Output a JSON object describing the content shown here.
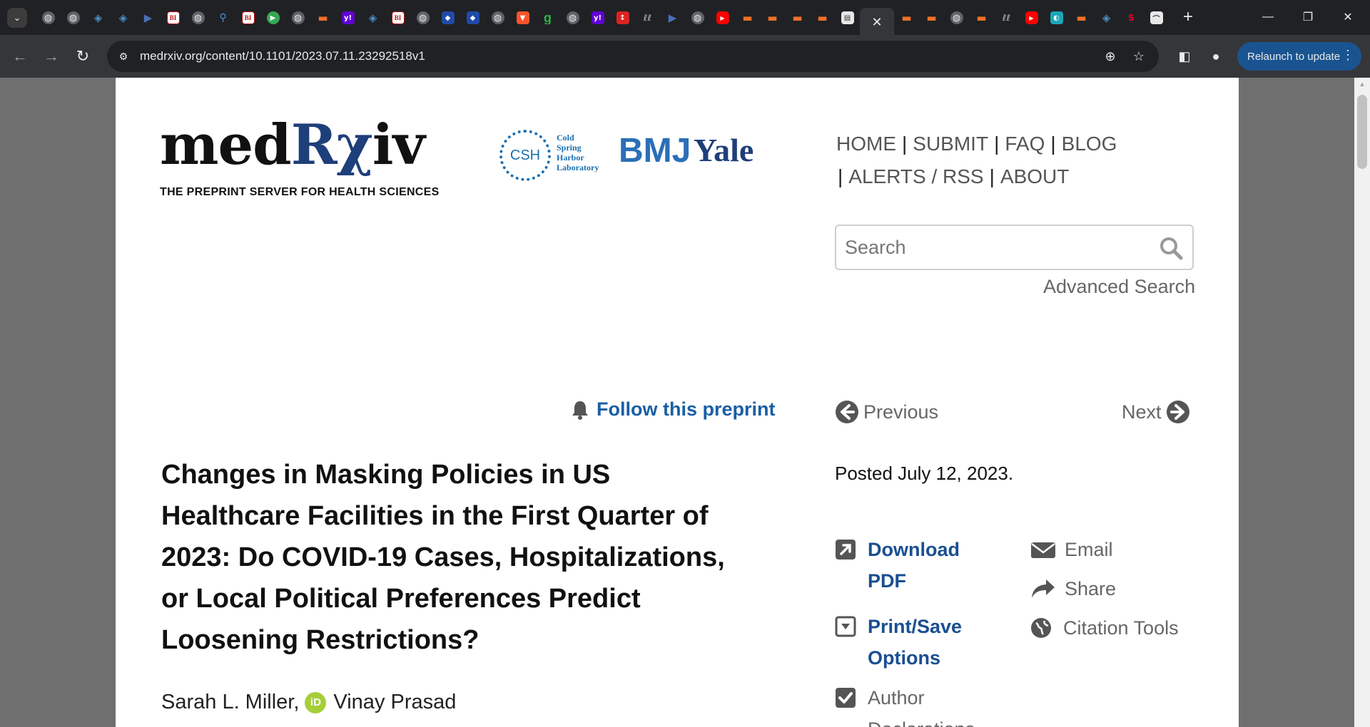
{
  "browser": {
    "tab_count_visible": 43,
    "active_tab_close": "✕",
    "url": "medrxiv.org/content/10.1101/2023.07.11.23292518v1",
    "relaunch_label": "Relaunch to update"
  },
  "header": {
    "logo_text": "medRχiv",
    "logo_part1": "med",
    "logo_part2": "Rχ",
    "logo_part3": "iv",
    "logo_subtitle": "THE PREPRINT SERVER FOR HEALTH SCIENCES",
    "partner_csh_seal": "CSH",
    "partner_csh_line1": "Cold",
    "partner_csh_line2": "Spring",
    "partner_csh_line3": "Harbor",
    "partner_csh_line4": "Laboratory",
    "partner_bmj": "BMJ",
    "partner_yale": "Yale"
  },
  "nav": {
    "items": [
      {
        "label": "HOME"
      },
      {
        "label": "SUBMIT"
      },
      {
        "label": "FAQ"
      },
      {
        "label": "BLOG"
      },
      {
        "label": "ALERTS / RSS"
      },
      {
        "label": "ABOUT"
      }
    ],
    "separator": "|"
  },
  "search": {
    "placeholder": "Search",
    "advanced_label": "Advanced Search"
  },
  "article_nav": {
    "follow_label": "Follow this preprint",
    "previous_label": "Previous",
    "next_label": "Next"
  },
  "article": {
    "title": "Changes in Masking Policies in US Healthcare Facilities in the First Quarter of 2023: Do COVID-19 Cases, Hospitalizations, or Local Political Preferences Predict Loosening Restrictions?",
    "author1": "Sarah L. Miller,",
    "author2": "Vinay Prasad",
    "orcid_mark": "iD",
    "posted": "Posted July 12, 2023."
  },
  "tools": {
    "download_pdf": "Download PDF",
    "print_save": "Print/Save Options",
    "author_declarations": "Author Declarations",
    "email": "Email",
    "share": "Share",
    "citation_tools": "Citation Tools"
  },
  "colors": {
    "link_blue": "#1a4f91",
    "logo_navy": "#1f3f7a",
    "chrome_dark": "#202124",
    "relaunch_blue": "#1a5490"
  }
}
